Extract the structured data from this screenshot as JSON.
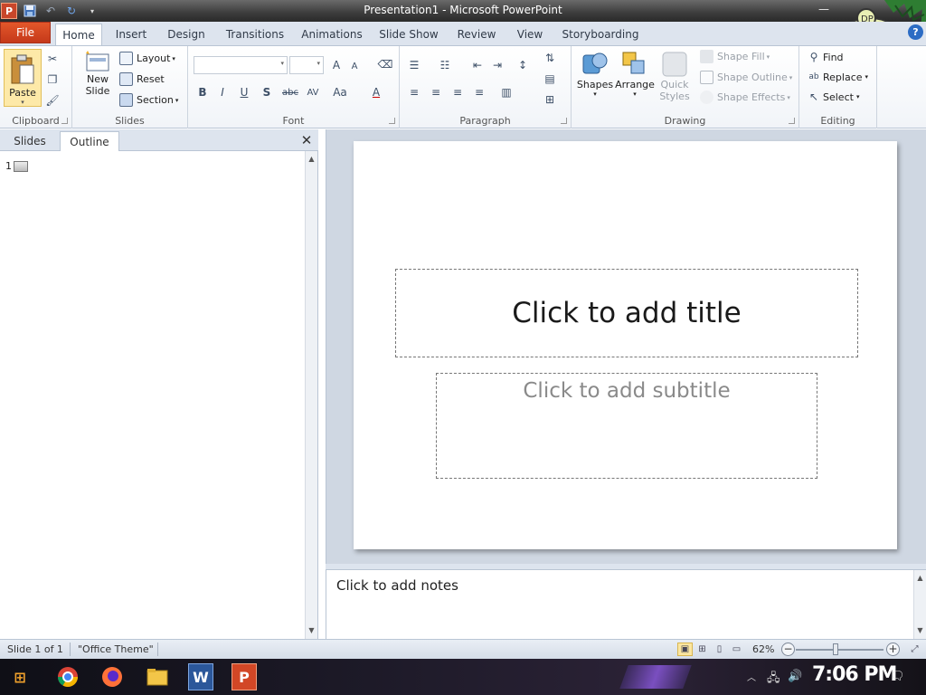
{
  "window": {
    "title": "Presentation1 - Microsoft PowerPoint",
    "app_logo_letter": "P",
    "controls": {
      "minimize": "—"
    }
  },
  "ribbon_tabs": {
    "file": "File",
    "tabs": [
      "Home",
      "Insert",
      "Design",
      "Transitions",
      "Animations",
      "Slide Show",
      "Review",
      "View",
      "Storyboarding"
    ],
    "active": "Home",
    "help": "?"
  },
  "ribbon": {
    "clipboard": {
      "label": "Clipboard",
      "paste": "Paste"
    },
    "slides": {
      "label": "Slides",
      "new_slide": "New Slide",
      "new_slide_line1": "New",
      "new_slide_line2": "Slide",
      "layout": "Layout",
      "reset": "Reset",
      "section": "Section"
    },
    "font": {
      "label": "Font",
      "bold": "B",
      "italic": "I",
      "underline": "U",
      "shadow": "S",
      "strike": "abc",
      "spacing": "AV",
      "case": "Aa",
      "color": "A",
      "grow": "A",
      "shrink": "A"
    },
    "paragraph": {
      "label": "Paragraph"
    },
    "drawing": {
      "label": "Drawing",
      "shapes": "Shapes",
      "arrange": "Arrange",
      "quick_styles_1": "Quick",
      "quick_styles_2": "Styles",
      "shape_fill": "Shape Fill",
      "shape_outline": "Shape Outline",
      "shape_effects": "Shape Effects"
    },
    "editing": {
      "label": "Editing",
      "find": "Find",
      "replace": "Replace",
      "select": "Select"
    }
  },
  "left_pane": {
    "tabs": [
      "Slides",
      "Outline"
    ],
    "active_tab": "Outline",
    "close": "✕",
    "slide_number": "1"
  },
  "slide": {
    "title_placeholder": "Click to add title",
    "subtitle_placeholder": "Click to add subtitle"
  },
  "notes": {
    "placeholder": "Click to add notes"
  },
  "status": {
    "slide_counter": "Slide 1 of 1",
    "theme": "\"Office Theme\"",
    "zoom": "62%",
    "zoom_level_fraction": 0.45
  },
  "taskbar": {
    "clock": "7:06 PM",
    "apps": [
      "chrome-icon",
      "firefox-icon",
      "file-explorer-icon",
      "word-icon",
      "powerpoint-icon"
    ]
  },
  "colors": {
    "file_tab": "#d24726",
    "ribbon_bg": "#f1f4f8",
    "accent_blue": "#2c6cc4"
  }
}
